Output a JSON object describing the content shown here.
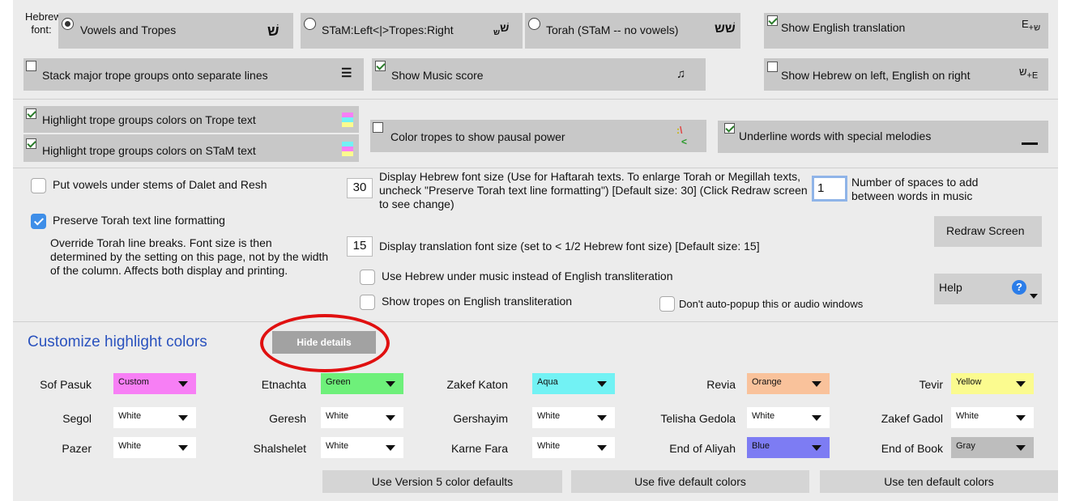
{
  "font_selector": {
    "label": "Hebrew font:",
    "options": [
      {
        "label": "Vowels and Tropes",
        "icon": "hebrew-vowels-icon",
        "selected": true
      },
      {
        "label": "STaM:Left<|>Tropes:Right",
        "icon": "stam-tropes-icon",
        "selected": false
      },
      {
        "label": "Torah (STaM -- no vowels)",
        "icon": "torah-stam-icon",
        "selected": false
      }
    ]
  },
  "toggles": {
    "show_english": {
      "label": "Show English translation",
      "checked": true
    },
    "stack_groups": {
      "label": "Stack major trope groups onto separate lines",
      "checked": false
    },
    "show_music": {
      "label": "Show Music score",
      "checked": true
    },
    "hebrew_left": {
      "label": "Show Hebrew on left, English on right",
      "checked": false
    },
    "highlight_trope": {
      "label": "Highlight trope groups colors on Trope text",
      "checked": true
    },
    "highlight_stam": {
      "label": "Highlight trope groups colors on STaM text",
      "checked": true
    },
    "color_pausal": {
      "label": "Color tropes to show pausal power",
      "checked": false
    },
    "underline_special": {
      "label": "Underline words with special melodies",
      "checked": true
    }
  },
  "options": {
    "vowels_dalet_resh": {
      "label": "Put vowels under stems of Dalet and Resh",
      "checked": false
    },
    "preserve_formatting": {
      "label": "Preserve Torah text line formatting",
      "checked": true
    },
    "override_note": "Override Torah line breaks. Font size is then determined by the setting on this page, not by the width of the column. Affects both display and printing.",
    "hebrew_font_size": {
      "value": "30",
      "text": "Display Hebrew font size (Use for Haftarah texts. To enlarge Torah or Megillah texts, uncheck \"Preserve Torah text line formatting\") [Default size: 30] (Click Redraw screen to see change)"
    },
    "translation_font_size": {
      "value": "15",
      "text": "Display translation font size (set to < 1/2 Hebrew font size) [Default size: 15]"
    },
    "spaces": {
      "value": "1",
      "text": "Number of spaces to add between words in music"
    },
    "hebrew_under_music": {
      "label": "Use Hebrew under music instead of English transliteration",
      "checked": false
    },
    "tropes_translit": {
      "label": "Show tropes on English transliteration",
      "checked": false
    },
    "no_autopopup": {
      "label": "Don't auto-popup this or audio windows",
      "checked": false
    },
    "redraw_label": "Redraw Screen",
    "help_label": "Help",
    "help_icon_glyph": "?"
  },
  "highlight": {
    "title": "Customize highlight colors",
    "hide_details_label": "Hide details",
    "rows": [
      [
        {
          "label": "Sof Pasuk",
          "value": "Custom",
          "color": "#f77ff5"
        },
        {
          "label": "Etnachta",
          "value": "Green",
          "color": "#6ef07a"
        },
        {
          "label": "Zakef Katon",
          "value": "Aqua",
          "color": "#72f2f4"
        },
        {
          "label": "Revia",
          "value": "Orange",
          "color": "#f9c29b"
        },
        {
          "label": "Tevir",
          "value": "Yellow",
          "color": "#fbfb8f"
        }
      ],
      [
        {
          "label": "Segol",
          "value": "White",
          "color": "#ffffff"
        },
        {
          "label": "Geresh",
          "value": "White",
          "color": "#ffffff"
        },
        {
          "label": "Gershayim",
          "value": "White",
          "color": "#ffffff"
        },
        {
          "label": "Telisha Gedola",
          "value": "White",
          "color": "#ffffff"
        },
        {
          "label": "Zakef Gadol",
          "value": "White",
          "color": "#ffffff"
        }
      ],
      [
        {
          "label": "Pazer",
          "value": "White",
          "color": "#ffffff"
        },
        {
          "label": "Shalshelet",
          "value": "White",
          "color": "#ffffff"
        },
        {
          "label": "Karne Fara",
          "value": "White",
          "color": "#ffffff"
        },
        {
          "label": "End of Aliyah",
          "value": "Blue",
          "color": "#7d7cf3"
        },
        {
          "label": "End of Book",
          "value": "Gray",
          "color": "#bdbdbd"
        }
      ]
    ],
    "defaults_buttons": [
      "Use Version 5 color defaults",
      "Use five default colors",
      "Use ten default colors"
    ]
  },
  "colors": {
    "title_blue": "#2a52be",
    "annotation_red": "#e01010",
    "help_blue": "#2b7de9"
  }
}
